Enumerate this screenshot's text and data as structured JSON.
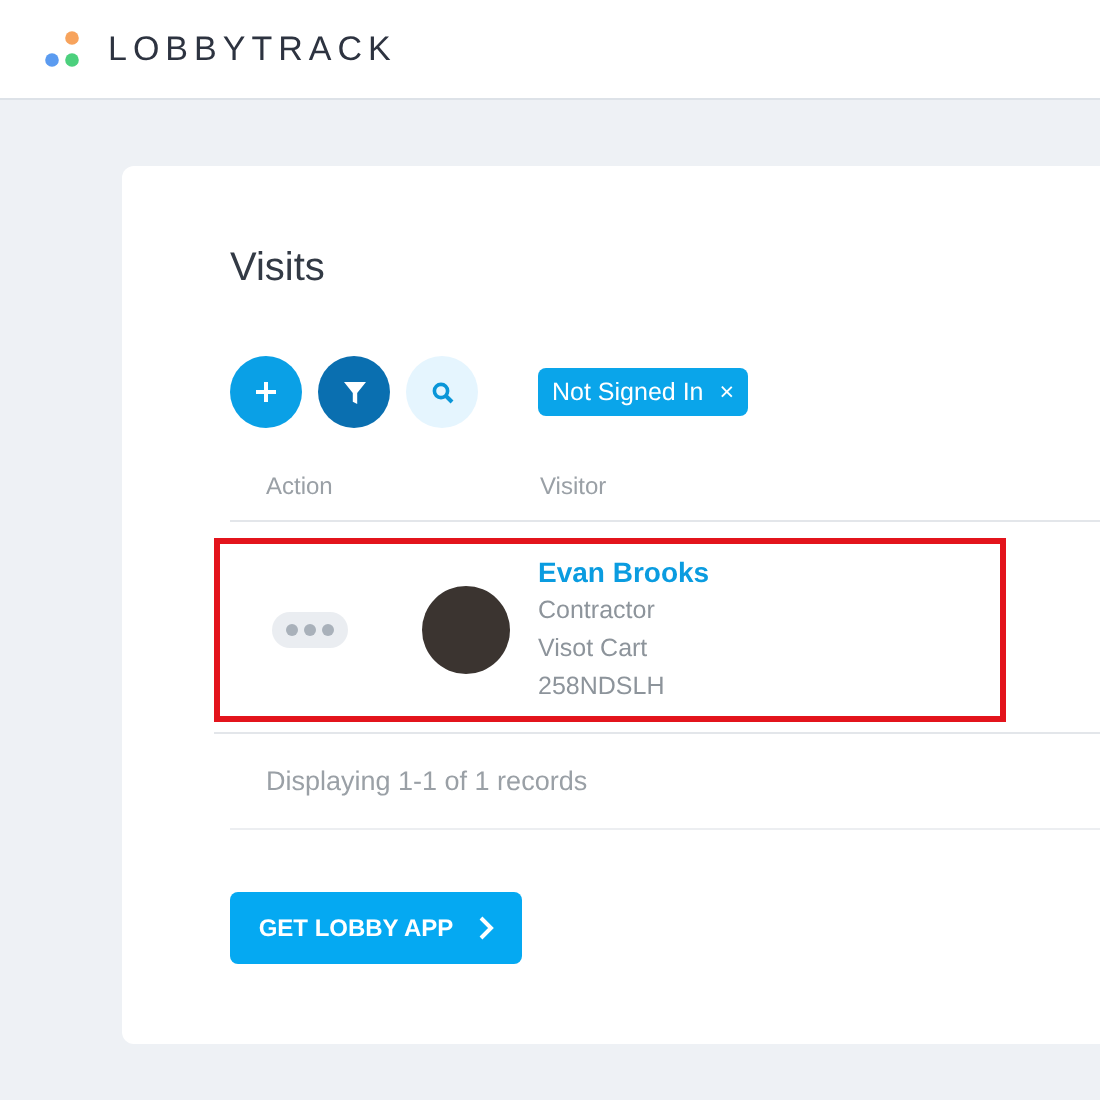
{
  "header": {
    "brand": "LOBBYTRACK"
  },
  "page": {
    "title": "Visits"
  },
  "toolbar": {
    "filter_active": true,
    "chips": [
      {
        "label": "Not Signed In",
        "remove": "×"
      }
    ]
  },
  "table": {
    "columns": [
      "Action",
      "Visitor"
    ],
    "rows": [
      {
        "highlighted": true,
        "name": "Evan Brooks",
        "lines": [
          "Contractor",
          "Visot Cart",
          "258NDSLH"
        ]
      }
    ]
  },
  "footer": {
    "summary": "Displaying 1-1 of 1 records"
  },
  "cta": {
    "label": "GET LOBBY APP"
  }
}
